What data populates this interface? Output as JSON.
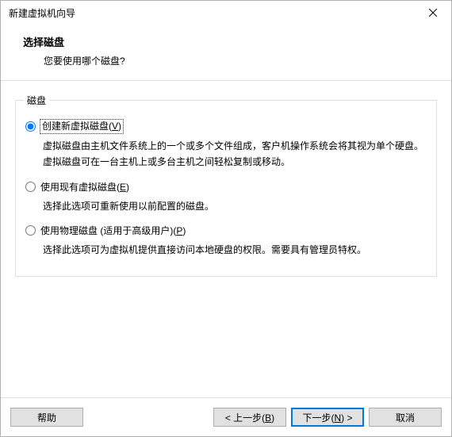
{
  "window": {
    "title": "新建虚拟机向导"
  },
  "header": {
    "title": "选择磁盘",
    "subtitle": "您要使用哪个磁盘?"
  },
  "group": {
    "legend": "磁盘"
  },
  "options": {
    "create_new": {
      "label_pre": "创建新虚拟磁盘(",
      "mnemonic": "V",
      "label_post": ")",
      "desc": "虚拟磁盘由主机文件系统上的一个或多个文件组成，客户机操作系统会将其视为单个硬盘。虚拟磁盘可在一台主机上或多台主机之间轻松复制或移动。",
      "selected": true
    },
    "use_existing": {
      "label_pre": "使用现有虚拟磁盘(",
      "mnemonic": "E",
      "label_post": ")",
      "desc": "选择此选项可重新使用以前配置的磁盘。",
      "selected": false
    },
    "use_physical": {
      "label_pre": "使用物理磁盘 (适用于高级用户)(",
      "mnemonic": "P",
      "label_post": ")",
      "desc": "选择此选项可为虚拟机提供直接访问本地硬盘的权限。需要具有管理员特权。",
      "selected": false
    }
  },
  "buttons": {
    "help": "帮助",
    "back_pre": "< 上一步(",
    "back_mn": "B",
    "back_post": ")",
    "next_pre": "下一步(",
    "next_mn": "N",
    "next_post": ") >",
    "cancel": "取消"
  }
}
